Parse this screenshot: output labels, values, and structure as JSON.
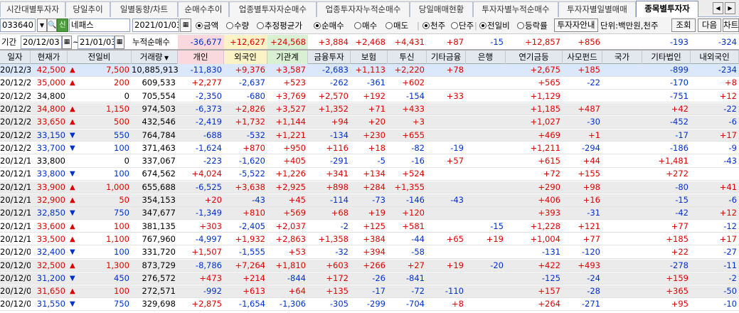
{
  "tabs": [
    "시간대별투자자",
    "당일추이",
    "일별동향/차트",
    "순매수추이",
    "업종별투자자순매수",
    "업종투자자누적순매수",
    "당일매매현황",
    "투자자별누적순매수",
    "투자자별일별매매",
    "종목별투자자"
  ],
  "active_tab": 9,
  "controls": {
    "code": "033640",
    "stock_badge": "신",
    "stock_name": "네패스",
    "date": "2021/01/03",
    "radio_amount": "금액",
    "radio_qty": "수량",
    "radio_avg": "추정평균가",
    "radio_net": "순매수",
    "radio_buy": "매수",
    "radio_sell": "매도",
    "radio_thousand": "천주",
    "radio_unit": "단주",
    "radio_prev": "전일비",
    "radio_rate": "등락률",
    "guide_btn": "투자자안내",
    "unit_label": "단위:백만원,천주",
    "query_btn": "조회",
    "next_btn": "다음",
    "chart_btn": "차트"
  },
  "summary": {
    "period_label": "기간",
    "from": "20/12/03",
    "tilde": "~",
    "to": "21/01/03",
    "cum_label": "누적순매수",
    "values": [
      "-36,677",
      "+12,627",
      "+24,568",
      "+3,884",
      "+2,468",
      "+4,431",
      "+87",
      "-15",
      "+12,857",
      "+856",
      "",
      "-193",
      "-324"
    ]
  },
  "headers": [
    "일자",
    "현재가",
    "전일비",
    "거래량",
    "개인",
    "외국인",
    "기관계",
    "금융투자",
    "보험",
    "투신",
    "기타금융",
    "은행",
    "연기금등",
    "사모펀드",
    "국가",
    "기타법인",
    "내외국인"
  ],
  "sort_icon": "▼",
  "rows": [
    [
      "20/12/30",
      "42,500",
      "up",
      "7,500",
      "10,885,913",
      "-11,830",
      "+9,376",
      "+3,587",
      "-2,683",
      "+1,113",
      "+2,220",
      "+78",
      "",
      "+2,675",
      "+185",
      "",
      "-899",
      "-234"
    ],
    [
      "20/12/29",
      "35,000",
      "up",
      "200",
      "609,533",
      "+2,277",
      "-2,637",
      "+523",
      "-262",
      "-361",
      "+602",
      "",
      "",
      "+565",
      "-22",
      "",
      "-170",
      "+8"
    ],
    [
      "20/12/28",
      "34,800",
      "",
      "0",
      "705,554",
      "-2,350",
      "-680",
      "+3,769",
      "+2,570",
      "+192",
      "-154",
      "+33",
      "",
      "+1,129",
      "",
      "",
      "-751",
      "+12"
    ],
    [
      "20/12/24",
      "34,800",
      "up",
      "1,150",
      "974,503",
      "-6,373",
      "+2,826",
      "+3,527",
      "+1,352",
      "+71",
      "+433",
      "",
      "",
      "+1,185",
      "+487",
      "",
      "+42",
      "-22"
    ],
    [
      "20/12/23",
      "33,650",
      "up",
      "500",
      "432,546",
      "-2,419",
      "+1,732",
      "+1,144",
      "+94",
      "+20",
      "+3",
      "",
      "",
      "+1,027",
      "-30",
      "",
      "-452",
      "-6"
    ],
    [
      "20/12/22",
      "33,150",
      "dn",
      "550",
      "764,784",
      "-688",
      "-532",
      "+1,221",
      "-134",
      "+230",
      "+655",
      "",
      "",
      "+469",
      "+1",
      "",
      "-17",
      "+17"
    ],
    [
      "20/12/21",
      "33,700",
      "dn",
      "100",
      "371,463",
      "-1,624",
      "+870",
      "+950",
      "+116",
      "+18",
      "-82",
      "-19",
      "",
      "+1,211",
      "-294",
      "",
      "-186",
      "-9"
    ],
    [
      "20/12/18",
      "33,800",
      "",
      "0",
      "337,067",
      "-223",
      "-1,620",
      "+405",
      "-291",
      "-5",
      "-16",
      "+57",
      "",
      "+615",
      "+44",
      "",
      "+1,481",
      "-43"
    ],
    [
      "20/12/17",
      "33,800",
      "dn",
      "100",
      "674,562",
      "+4,024",
      "-5,522",
      "+1,226",
      "+341",
      "+134",
      "+524",
      "",
      "",
      "+72",
      "+155",
      "",
      "+272",
      ""
    ],
    [
      "20/12/16",
      "33,900",
      "up",
      "1,000",
      "655,688",
      "-6,525",
      "+3,638",
      "+2,925",
      "+898",
      "+284",
      "+1,355",
      "",
      "",
      "+290",
      "+98",
      "",
      "-80",
      "+41"
    ],
    [
      "20/12/15",
      "32,900",
      "up",
      "50",
      "354,153",
      "+20",
      "-43",
      "+45",
      "-114",
      "-73",
      "-146",
      "-43",
      "",
      "+406",
      "+16",
      "",
      "-15",
      "-6"
    ],
    [
      "20/12/14",
      "32,850",
      "dn",
      "750",
      "347,677",
      "-1,349",
      "+810",
      "+569",
      "+68",
      "+19",
      "+120",
      "",
      "",
      "+393",
      "-31",
      "",
      "-42",
      "+12"
    ],
    [
      "20/12/11",
      "33,600",
      "up",
      "100",
      "381,135",
      "+303",
      "-2,405",
      "+2,037",
      "-2",
      "+125",
      "+581",
      "",
      "-15",
      "+1,228",
      "+121",
      "",
      "+77",
      "-12"
    ],
    [
      "20/12/10",
      "33,500",
      "up",
      "1,100",
      "767,960",
      "-4,997",
      "+1,932",
      "+2,863",
      "+1,358",
      "+384",
      "-44",
      "+65",
      "+19",
      "+1,004",
      "+77",
      "",
      "+185",
      "+17"
    ],
    [
      "20/12/09",
      "32,400",
      "dn",
      "100",
      "331,720",
      "+1,507",
      "-1,555",
      "+53",
      "-32",
      "+394",
      "-58",
      "",
      "",
      "-131",
      "-120",
      "",
      "+22",
      "-27"
    ],
    [
      "20/12/08",
      "32,500",
      "up",
      "1,300",
      "873,729",
      "-8,786",
      "+7,264",
      "+1,810",
      "+603",
      "+266",
      "+27",
      "+19",
      "-20",
      "+422",
      "+493",
      "",
      "-278",
      "-11"
    ],
    [
      "20/12/07",
      "31,200",
      "dn",
      "450",
      "276,572",
      "+473",
      "+214",
      "-844",
      "+172",
      "-26",
      "-841",
      "",
      "",
      "-125",
      "-24",
      "",
      "+159",
      "-2"
    ],
    [
      "20/12/04",
      "31,650",
      "up",
      "100",
      "272,571",
      "-992",
      "+613",
      "+64",
      "+135",
      "-17",
      "-72",
      "-110",
      "",
      "+157",
      "-28",
      "",
      "+365",
      "-50"
    ],
    [
      "20/12/03",
      "31,550",
      "dn",
      "750",
      "329,698",
      "+2,875",
      "-1,654",
      "-1,306",
      "-305",
      "-299",
      "-704",
      "+8",
      "",
      "+264",
      "-271",
      "",
      "+95",
      "-10"
    ]
  ]
}
